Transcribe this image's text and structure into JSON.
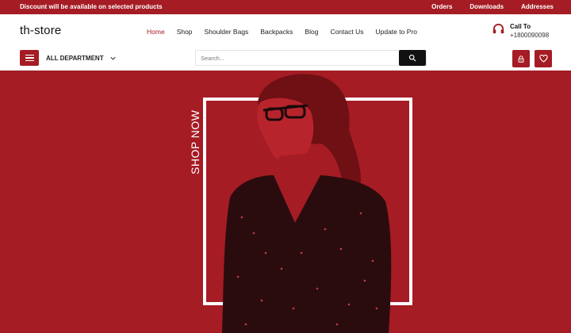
{
  "topbar": {
    "promo": "Discount will be available on selected products",
    "links": [
      "Orders",
      "Downloads",
      "Addresses"
    ]
  },
  "header": {
    "logo": "th-store",
    "nav": [
      "Home",
      "Shop",
      "Shoulder Bags",
      "Backpacks",
      "Blog",
      "Contact Us",
      "Update to Pro"
    ],
    "active_nav": "Home",
    "call_title": "Call To",
    "call_number": "+1800090098"
  },
  "toolbar": {
    "department_label": "ALL DEPARTMENT",
    "search_placeholder": "Search..."
  },
  "hero": {
    "cta": "SHOP NOW"
  },
  "icons": {
    "menu": "hamburger-icon",
    "dropdown": "chevron-down-icon",
    "search": "search-icon",
    "account": "lock-icon",
    "wishlist": "heart-icon",
    "call": "headphones-icon"
  },
  "colors": {
    "accent": "#a51c24",
    "search_button": "#111111",
    "text": "#222222"
  }
}
